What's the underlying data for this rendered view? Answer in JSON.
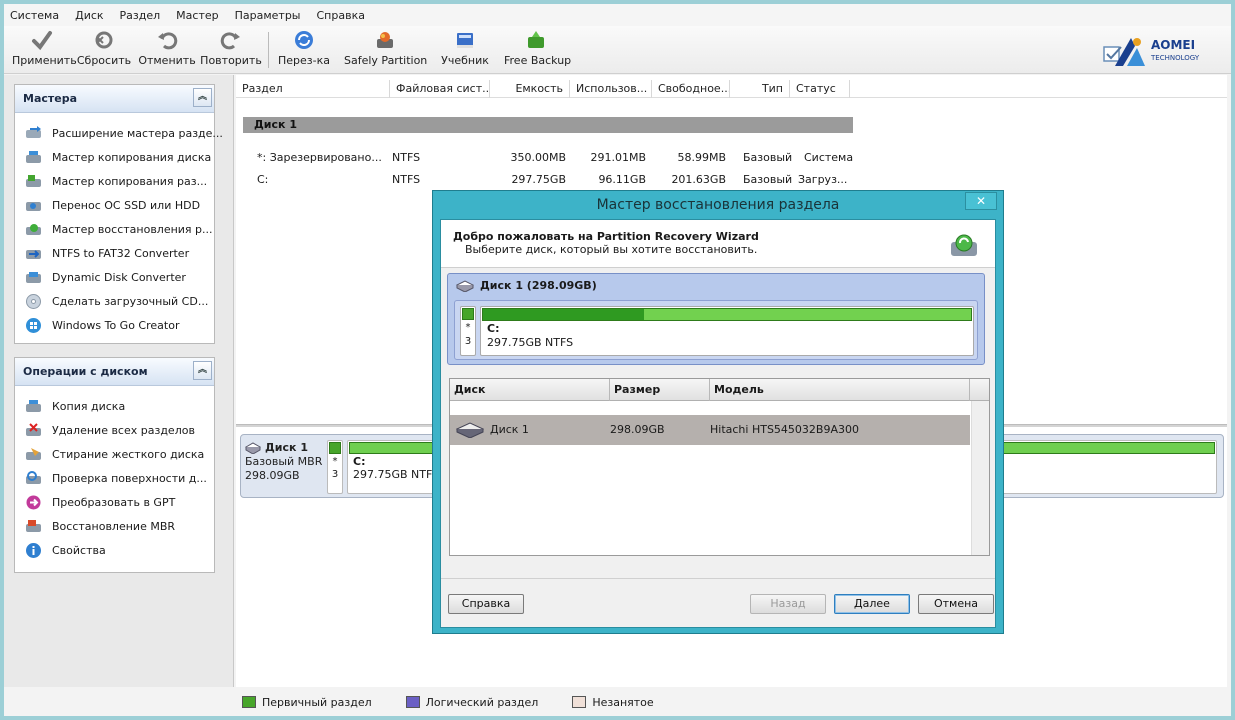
{
  "menu": [
    "Система",
    "Диск",
    "Раздел",
    "Мастер",
    "Параметры",
    "Справка"
  ],
  "toolbar": {
    "apply": "Применить",
    "reset": "Сбросить",
    "undo": "Отменить",
    "redo": "Повторить",
    "reload": "Перез-ка",
    "safely": "Safely Partition",
    "tutorial": "Учебник",
    "backup": "Free Backup"
  },
  "logo": {
    "brand": "AOMEI",
    "sub": "TECHNOLOGY"
  },
  "sidebar": {
    "wizards_title": "Мастера",
    "wizards": [
      "Расширение мастера разде...",
      "Мастер копирования диска",
      "Мастер копирования раз...",
      "Перенос ОС SSD или HDD",
      "Мастер восстановления р...",
      "NTFS to FAT32 Converter",
      "Dynamic Disk Converter",
      "Сделать загрузочный CD...",
      "Windows To Go Creator"
    ],
    "ops_title": "Операции с диском",
    "ops": [
      "Копия диска",
      "Удаление всех разделов",
      "Стирание жесткого диска",
      "Проверка поверхности д...",
      "Преобразовать в GPT",
      "Восстановление MBR",
      "Свойства"
    ]
  },
  "table": {
    "columns": [
      "Раздел",
      "Файловая сист...",
      "Емкость",
      "Использов...",
      "Свободное...",
      "Тип",
      "Статус"
    ],
    "disk_label": "Диск 1",
    "rows": [
      {
        "name": "*: Зарезервировано...",
        "fs": "NTFS",
        "cap": "350.00MB",
        "used": "291.01MB",
        "free": "58.99MB",
        "type": "Базовый",
        "status": "Система"
      },
      {
        "name": "C:",
        "fs": "NTFS",
        "cap": "297.75GB",
        "used": "96.11GB",
        "free": "201.63GB",
        "type": "Базовый",
        "status": "Загруз..."
      }
    ]
  },
  "diskmap": {
    "name": "Диск 1",
    "kind": "Базовый MBR",
    "size": "298.09GB",
    "small_star": "*",
    "small_num": "3",
    "part_letter": "C:",
    "part_info": "297.75GB NTFS"
  },
  "legend": {
    "primary": "Первичный раздел",
    "logical": "Логический раздел",
    "free": "Незанятое"
  },
  "colors": {
    "primary": "#47a52a",
    "logical": "#6a5fc4",
    "free": "#f0e0d8",
    "dialog_frame": "#3db3c8"
  },
  "dialog": {
    "title": "Мастер восстановления раздела",
    "close": "✕",
    "heading": "Добро пожаловать на Partition Recovery Wizard",
    "subheading": "Выберите диск, который вы хотите восстановить.",
    "disk_header": "Диск 1 (298.09GB)",
    "small_star": "*",
    "small_num": "3",
    "part_letter": "C:",
    "part_info": "297.75GB NTFS",
    "used_fraction": 0.33,
    "columns": [
      "Диск",
      "Размер",
      "Модель"
    ],
    "row": {
      "disk": "Диск 1",
      "size": "298.09GB",
      "model": "Hitachi HTS545032B9A300"
    },
    "buttons": {
      "help": "Справка",
      "back": "Назад",
      "next": "Далее",
      "cancel": "Отмена"
    }
  }
}
